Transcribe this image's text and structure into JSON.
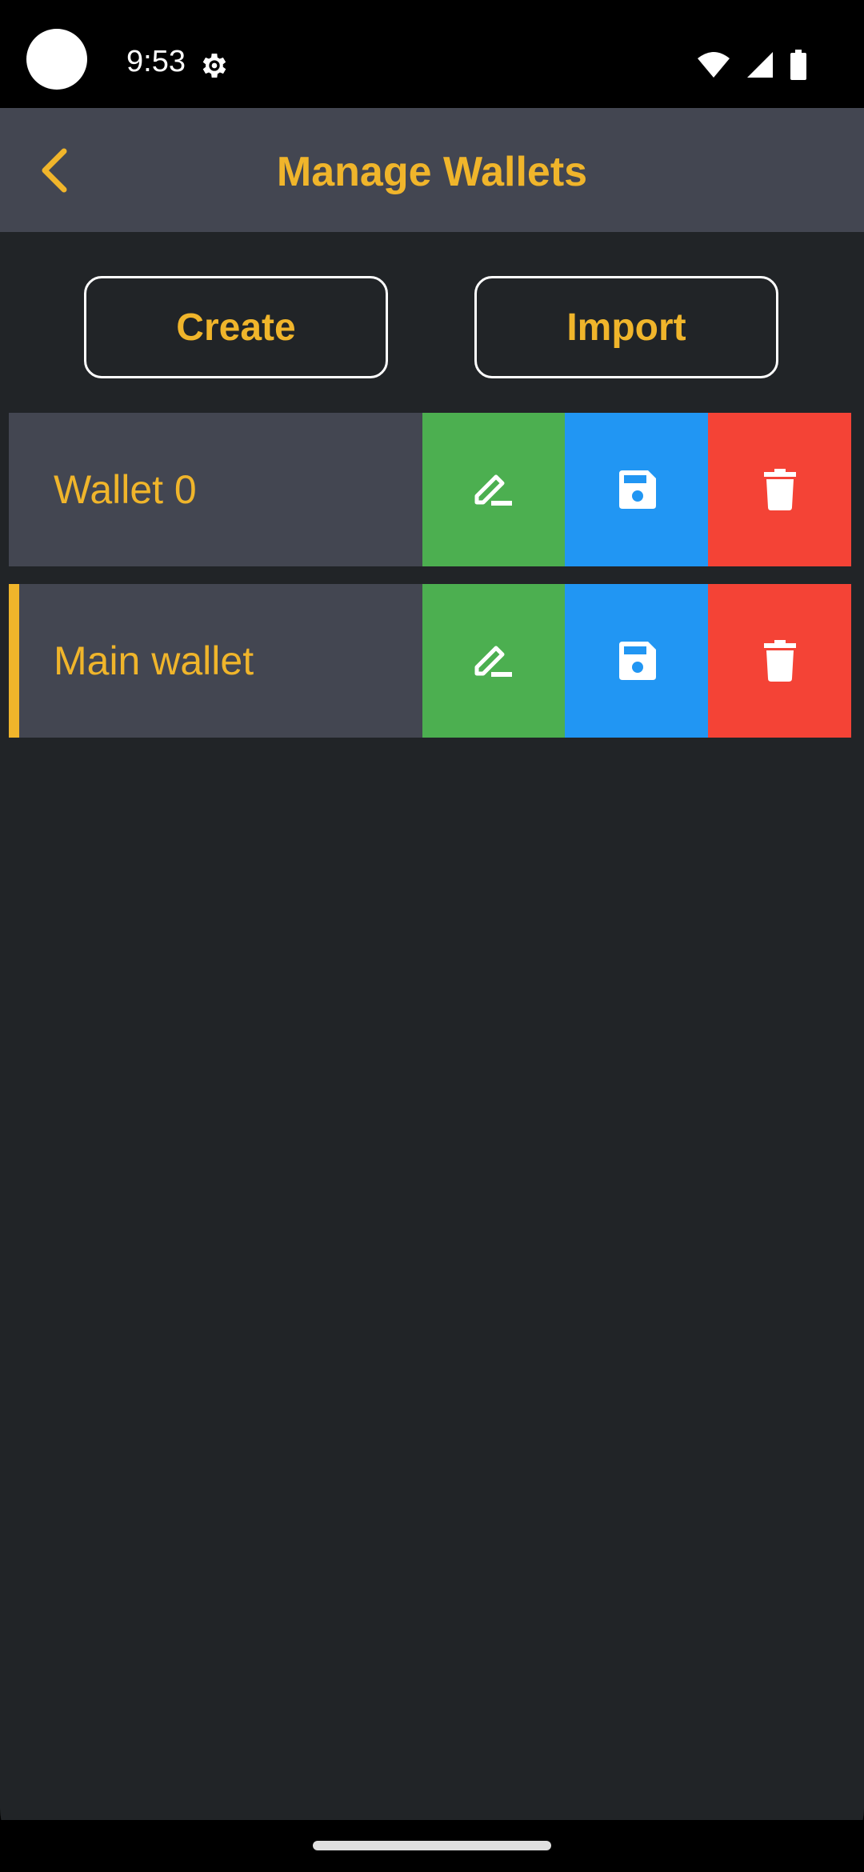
{
  "status_bar": {
    "time": "9:53",
    "icons": [
      "camera-cutout",
      "gear-icon",
      "wifi-icon",
      "signal-icon",
      "battery-icon"
    ]
  },
  "app_bar": {
    "title": "Manage Wallets",
    "back_icon": "chevron-left-icon"
  },
  "actions": {
    "create_label": "Create",
    "import_label": "Import"
  },
  "wallets": [
    {
      "name": "Wallet 0",
      "selected": false
    },
    {
      "name": "Main wallet",
      "selected": true
    }
  ],
  "row_actions": {
    "edit_icon": "pencil-icon",
    "save_icon": "floppy-disk-icon",
    "delete_icon": "trash-icon"
  },
  "colors": {
    "accent": "#f0b52b",
    "app_bar_bg": "#434651",
    "background": "#212427",
    "edit": "#4caf50",
    "save": "#2196f3",
    "delete": "#f44336"
  }
}
